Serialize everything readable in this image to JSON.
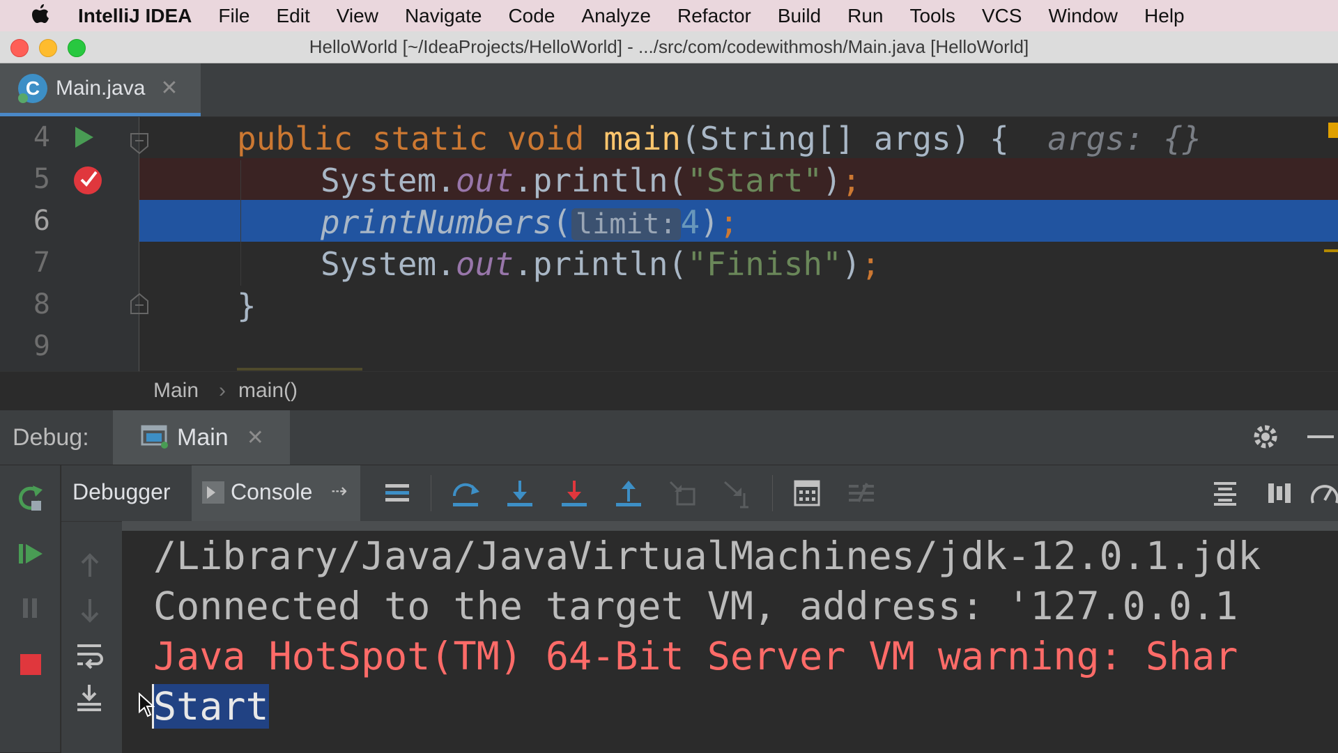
{
  "menubar": {
    "app": "IntelliJ IDEA",
    "items": [
      "File",
      "Edit",
      "View",
      "Navigate",
      "Code",
      "Analyze",
      "Refactor",
      "Build",
      "Run",
      "Tools",
      "VCS",
      "Window",
      "Help"
    ]
  },
  "window": {
    "title": "HelloWorld [~/IdeaProjects/HelloWorld] - .../src/com/codewithmosh/Main.java [HelloWorld]"
  },
  "editor": {
    "tab": {
      "label": "Main.java",
      "close": "✕"
    },
    "line_numbers": [
      "4",
      "5",
      "6",
      "7",
      "8",
      "9"
    ],
    "lines": {
      "l4": {
        "kw1": "public static void ",
        "fn": "main",
        "rest": "(String[] args) {",
        "hint": "args: {}"
      },
      "l5": {
        "a": "System.",
        "field": "out",
        "b": ".println(",
        "str": "\"Start\"",
        "c": ")",
        "semi": ";"
      },
      "l6": {
        "call": "printNumbers",
        "open": "(",
        "param_hint": "limit:",
        "arg": "4",
        "close": ")",
        "semi": ";"
      },
      "l7": {
        "a": "System.",
        "field": "out",
        "b": ".println(",
        "str": "\"Finish\"",
        "c": ")",
        "semi": ";"
      },
      "l8": {
        "brace": "}"
      }
    },
    "breadcrumb": {
      "class": "Main",
      "sep": "›",
      "method": "main()"
    }
  },
  "debug": {
    "label": "Debug:",
    "session_tab": {
      "label": "Main",
      "close": "✕"
    },
    "tabs": {
      "debugger": "Debugger",
      "console": "Console"
    },
    "console_lines": [
      "/Library/Java/JavaVirtualMachines/jdk-12.0.1.jdk",
      "Connected to the target VM, address: '127.0.0.1",
      "Java HotSpot(TM) 64-Bit Server VM warning: Shar",
      "Start"
    ]
  },
  "colors": {
    "accent": "#4a88c7",
    "exec_line": "#2154a0",
    "breakpoint": "#e0373d",
    "run_green": "#499c54",
    "error_text": "#ff6b68"
  }
}
